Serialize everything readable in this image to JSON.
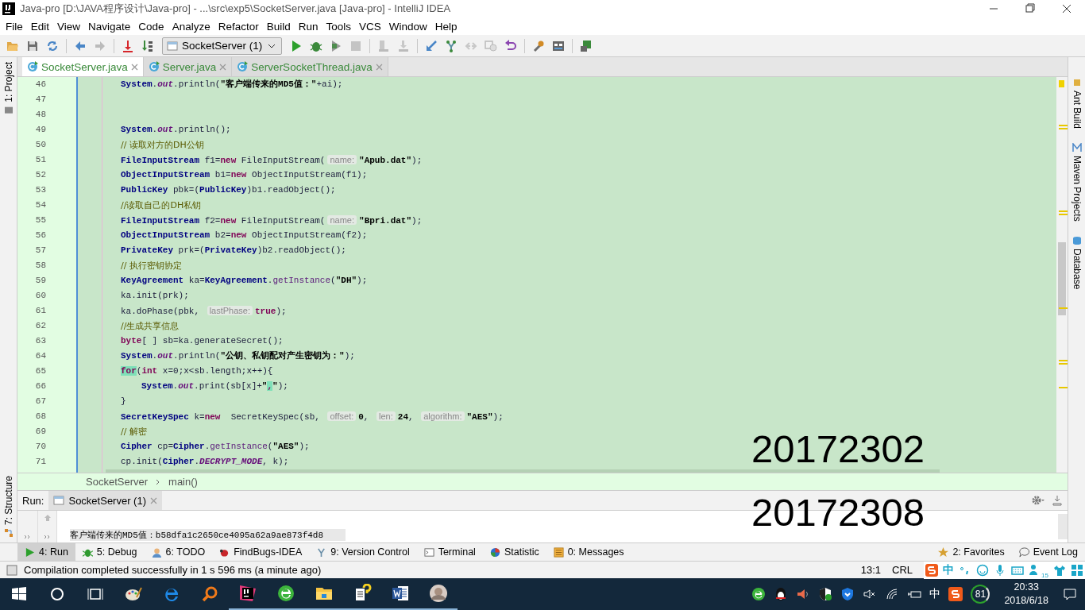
{
  "window": {
    "title": "Java-pro [D:\\JAVA程序设计\\Java-pro] - ...\\src\\exp5\\SocketServer.java [Java-pro] - IntelliJ IDEA"
  },
  "menu": [
    "File",
    "Edit",
    "View",
    "Navigate",
    "Code",
    "Analyze",
    "Refactor",
    "Build",
    "Run",
    "Tools",
    "VCS",
    "Window",
    "Help"
  ],
  "toolbar": {
    "run_config": "SocketServer (1)"
  },
  "left_tools": [
    "1: Project",
    "7: Structure"
  ],
  "right_tools": [
    "Ant Build",
    "Maven Projects",
    "Database"
  ],
  "tabs": [
    {
      "label": "SocketServer.java",
      "selected": true
    },
    {
      "label": "Server.java",
      "selected": false
    },
    {
      "label": "ServerSocketThread.java",
      "selected": false
    }
  ],
  "editor": {
    "lines": [
      {
        "number": "46",
        "tokens": [
          {
            "t": "System",
            "kind": "keyword"
          },
          {
            "t": ".",
            "kind": "plain"
          },
          {
            "t": "out",
            "kind": "field"
          },
          {
            "t": ".println(",
            "kind": "plain"
          },
          {
            "t": "\"客户端传来的MD5值：\"",
            "kind": "string"
          },
          {
            "t": "+ai);",
            "kind": "plain"
          }
        ]
      },
      {
        "number": "47"
      },
      {
        "number": "48"
      },
      {
        "number": "49",
        "tokens": [
          {
            "t": "System",
            "kind": "keyword"
          },
          {
            "t": ".",
            "kind": "plain"
          },
          {
            "t": "out",
            "kind": "field"
          },
          {
            "t": ".println();",
            "kind": "plain"
          }
        ]
      },
      {
        "number": "50",
        "tokens": [
          {
            "t": "// 读取对方的DH公钥",
            "kind": "comment"
          }
        ]
      },
      {
        "number": "51",
        "tokens": [
          {
            "t": "FileInputStream",
            "kind": "keyword"
          },
          {
            "t": " f1=",
            "kind": "plain"
          },
          {
            "t": "new",
            "kind": "reserved"
          },
          {
            "t": " FileInputStream(",
            "kind": "plain"
          },
          {
            "t": "name:",
            "kind": "hint"
          },
          {
            "t": "\"Apub.dat\"",
            "kind": "string"
          },
          {
            "t": ");",
            "kind": "plain"
          }
        ]
      },
      {
        "number": "52",
        "tokens": [
          {
            "t": "ObjectInputStream",
            "kind": "keyword"
          },
          {
            "t": " b1=",
            "kind": "plain"
          },
          {
            "t": "new",
            "kind": "reserved"
          },
          {
            "t": " ObjectInputStream(f1);",
            "kind": "plain"
          }
        ]
      },
      {
        "number": "53",
        "tokens": [
          {
            "t": "PublicKey",
            "kind": "keyword"
          },
          {
            "t": " pbk=(",
            "kind": "plain"
          },
          {
            "t": "PublicKey",
            "kind": "keyword"
          },
          {
            "t": ")b1.readObject();",
            "kind": "plain"
          }
        ]
      },
      {
        "number": "54",
        "tokens": [
          {
            "t": "//读取自己的DH私钥",
            "kind": "comment"
          }
        ]
      },
      {
        "number": "55",
        "tokens": [
          {
            "t": "FileInputStream",
            "kind": "keyword"
          },
          {
            "t": " f2=",
            "kind": "plain"
          },
          {
            "t": "new",
            "kind": "reserved"
          },
          {
            "t": " FileInputStream(",
            "kind": "plain"
          },
          {
            "t": "name:",
            "kind": "hint"
          },
          {
            "t": "\"Bpri.dat\"",
            "kind": "string"
          },
          {
            "t": ");",
            "kind": "plain"
          }
        ]
      },
      {
        "number": "56",
        "tokens": [
          {
            "t": "ObjectInputStream",
            "kind": "keyword"
          },
          {
            "t": " b2=",
            "kind": "plain"
          },
          {
            "t": "new",
            "kind": "reserved"
          },
          {
            "t": " ObjectInputStream(f2);",
            "kind": "plain"
          }
        ]
      },
      {
        "number": "57",
        "tokens": [
          {
            "t": "PrivateKey",
            "kind": "keyword"
          },
          {
            "t": " prk=(",
            "kind": "plain"
          },
          {
            "t": "PrivateKey",
            "kind": "keyword"
          },
          {
            "t": ")b2.readObject();",
            "kind": "plain"
          }
        ]
      },
      {
        "number": "58",
        "tokens": [
          {
            "t": "// 执行密钥协定",
            "kind": "comment"
          }
        ]
      },
      {
        "number": "59",
        "tokens": [
          {
            "t": "KeyAgreement",
            "kind": "keyword"
          },
          {
            "t": " ka=",
            "kind": "plain"
          },
          {
            "t": "KeyAgreement",
            "kind": "keyword"
          },
          {
            "t": ".",
            "kind": "plain"
          },
          {
            "t": "getInstance",
            "kind": "method"
          },
          {
            "t": "(",
            "kind": "plain"
          },
          {
            "t": "\"DH\"",
            "kind": "string"
          },
          {
            "t": ");",
            "kind": "plain"
          }
        ]
      },
      {
        "number": "60",
        "tokens": [
          {
            "t": "ka.init(prk);",
            "kind": "plain"
          }
        ]
      },
      {
        "number": "61",
        "tokens": [
          {
            "t": "ka.doPhase(pbk, ",
            "kind": "plain"
          },
          {
            "t": "lastPhase:",
            "kind": "hint"
          },
          {
            "t": "true",
            "kind": "reserved"
          },
          {
            "t": ");",
            "kind": "plain"
          }
        ]
      },
      {
        "number": "62",
        "tokens": [
          {
            "t": "//生成共享信息",
            "kind": "comment"
          }
        ]
      },
      {
        "number": "63",
        "tokens": [
          {
            "t": "byte",
            "kind": "reserved"
          },
          {
            "t": "[ ] sb=ka.generateSecret();",
            "kind": "plain"
          }
        ]
      },
      {
        "number": "64",
        "tokens": [
          {
            "t": "System",
            "kind": "keyword"
          },
          {
            "t": ".",
            "kind": "plain"
          },
          {
            "t": "out",
            "kind": "field"
          },
          {
            "t": ".println(",
            "kind": "plain"
          },
          {
            "t": "\"公钥、私钥配对产生密钥为：\"",
            "kind": "string"
          },
          {
            "t": ");",
            "kind": "plain"
          }
        ]
      },
      {
        "number": "65",
        "tokens": [
          {
            "t": "for",
            "kind": "matched"
          },
          {
            "t": "(",
            "kind": "plain"
          },
          {
            "t": "int",
            "kind": "reserved"
          },
          {
            "t": " x=0;x<sb.length;x++){",
            "kind": "plain"
          }
        ],
        "children": [
          {
            "number": "66",
            "tokens": [
              {
                "t": "System",
                "kind": "keyword"
              },
              {
                "t": ".",
                "kind": "plain"
              },
              {
                "t": "out",
                "kind": "field"
              },
              {
                "t": ".print(sb[x]+",
                "kind": "plain"
              },
              {
                "t": "\"",
                "kind": "string"
              },
              {
                "t": ",",
                "kind": "matched"
              },
              {
                "t": "\"",
                "kind": "string"
              },
              {
                "t": ");",
                "kind": "plain"
              }
            ]
          }
        ]
      },
      {
        "number": "67",
        "tokens": [
          {
            "t": "}",
            "kind": "plain"
          }
        ]
      },
      {
        "number": "68",
        "tokens": [
          {
            "t": "SecretKeySpec",
            "kind": "keyword"
          },
          {
            "t": " k=",
            "kind": "plain"
          },
          {
            "t": "new",
            "kind": "reserved"
          },
          {
            "t": "  SecretKeySpec(sb, ",
            "kind": "plain"
          },
          {
            "t": "offset:",
            "kind": "hint"
          },
          {
            "t": "0",
            "kind": "string"
          },
          {
            "t": ", ",
            "kind": "plain"
          },
          {
            "t": "len:",
            "kind": "hint"
          },
          {
            "t": "24",
            "kind": "string"
          },
          {
            "t": ", ",
            "kind": "plain"
          },
          {
            "t": "algorithm:",
            "kind": "hint"
          },
          {
            "t": "\"AES\"",
            "kind": "string"
          },
          {
            "t": ");",
            "kind": "plain"
          }
        ]
      },
      {
        "number": "69",
        "tokens": [
          {
            "t": "// 解密",
            "kind": "comment"
          }
        ]
      },
      {
        "number": "70",
        "tokens": [
          {
            "t": "Cipher",
            "kind": "keyword"
          },
          {
            "t": " cp=",
            "kind": "plain"
          },
          {
            "t": "Cipher",
            "kind": "keyword"
          },
          {
            "t": ".",
            "kind": "plain"
          },
          {
            "t": "getInstance",
            "kind": "method"
          },
          {
            "t": "(",
            "kind": "plain"
          },
          {
            "t": "\"AES\"",
            "kind": "string"
          },
          {
            "t": ");",
            "kind": "plain"
          }
        ]
      },
      {
        "number": "71",
        "tokens": [
          {
            "t": "cp.init(",
            "kind": "plain"
          },
          {
            "t": "Cipher",
            "kind": "keyword"
          },
          {
            "t": ".",
            "kind": "plain"
          },
          {
            "t": "DECRYPT_MODE",
            "kind": "field"
          },
          {
            "t": ", k);",
            "kind": "plain"
          }
        ]
      }
    ]
  },
  "breadcrumbs": [
    "SocketServer",
    "main()"
  ],
  "run": {
    "label": "Run:",
    "tab": "SocketServer (1)",
    "output": "客户端传来的MD5值：b58dfa1c2650ce4095a62a9ae873f4d8"
  },
  "overlay": [
    "20172302",
    "20172308"
  ],
  "tool_buttons": [
    {
      "label": "4: Run",
      "selected": true
    },
    {
      "label": "5: Debug",
      "selected": false
    },
    {
      "label": "6: TODO",
      "selected": false
    },
    {
      "label": "FindBugs-IDEA",
      "selected": false
    },
    {
      "label": "9: Version Control",
      "selected": false
    },
    {
      "label": "Terminal",
      "selected": false
    },
    {
      "label": "Statistic",
      "selected": false
    },
    {
      "label": "0: Messages",
      "selected": false
    }
  ],
  "right_tool_buttons": [
    "2: Favorites",
    "Event Log"
  ],
  "status": {
    "message": "Compilation completed successfully in 1 s 596 ms (a minute ago)",
    "position": "13:1",
    "line_sep": "CRL"
  },
  "ime": {
    "mode": "中",
    "badge": "15"
  },
  "taskbar": {
    "ime": "中",
    "battery": "81",
    "time": "20:33",
    "date": "2018/6/18"
  }
}
